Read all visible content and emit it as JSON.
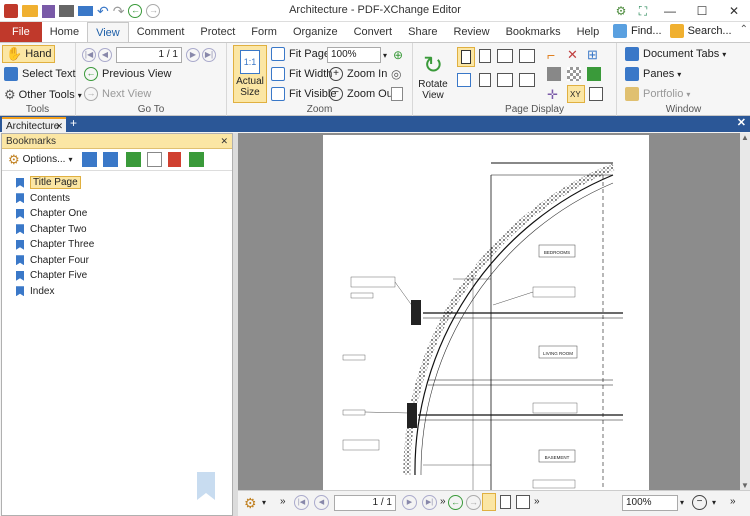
{
  "window": {
    "title": "Architecture - PDF-XChange Editor",
    "controls": [
      "—",
      "☐",
      "✕"
    ]
  },
  "quick_access": [
    "open-icon",
    "save-icon",
    "print-icon",
    "scan-icon",
    "undo-icon",
    "redo-icon",
    "back-icon",
    "forward-icon"
  ],
  "menu": {
    "file": "File",
    "items": [
      "Home",
      "View",
      "Comment",
      "Protect",
      "Form",
      "Organize",
      "Convert",
      "Share",
      "Review",
      "Bookmarks",
      "Help"
    ],
    "active": "View",
    "find": "Find...",
    "search": "Search..."
  },
  "ribbon": {
    "tools": {
      "label": "Tools",
      "hand": "Hand",
      "select_text": "Select Text",
      "other_tools": "Other Tools"
    },
    "goto": {
      "label": "Go To",
      "page_value": "1 / 1",
      "previous_view": "Previous View",
      "next_view": "Next View"
    },
    "zoom": {
      "label": "Zoom",
      "actual_size": "Actual Size",
      "actual_size_glyph": "1:1",
      "fit_page": "Fit Page",
      "fit_width": "Fit Width",
      "fit_visible": "Fit Visible",
      "zoom_value": "100%",
      "zoom_in": "Zoom In",
      "zoom_out": "Zoom Out"
    },
    "rotate": {
      "label": "Rotate View"
    },
    "page_display": {
      "label": "Page Display"
    },
    "window": {
      "label": "Window",
      "document_tabs": "Document Tabs",
      "panes": "Panes",
      "portfolio": "Portfolio"
    }
  },
  "document_tab": {
    "label": "Architecture"
  },
  "bookmarks_panel": {
    "title": "Bookmarks",
    "options": "Options...",
    "items": [
      "Title Page",
      "Contents",
      "Chapter One",
      "Chapter Two",
      "Chapter Three",
      "Chapter Four",
      "Chapter Five",
      "Index"
    ],
    "selected": "Title Page"
  },
  "drawing": {
    "labels": [
      "BEDROOMS",
      "LIVING ROOM",
      "BASEMENT"
    ]
  },
  "status": {
    "page_value": "1 / 1",
    "zoom": "100%"
  },
  "colors": {
    "file_tab": "#c0392b",
    "accent_blue": "#2b5797",
    "selection": "#fbe6a4",
    "viewer_bg": "#8c8c8c"
  }
}
